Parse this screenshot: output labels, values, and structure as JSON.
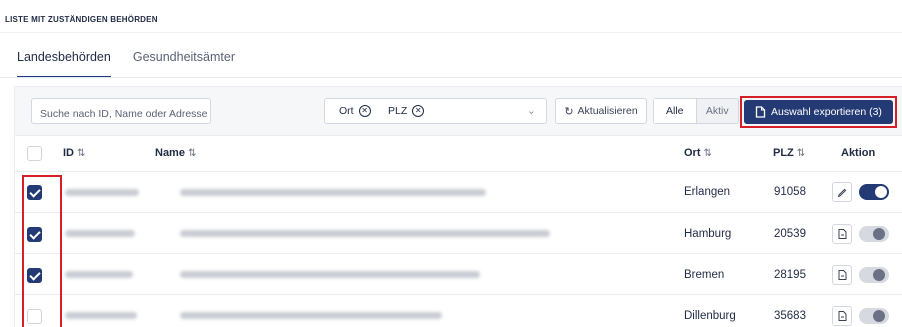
{
  "page_title": "LISTE MIT ZUSTÄNDIGEN BEHÖRDEN",
  "tabs": [
    {
      "label": "Landesbehörden",
      "active": true
    },
    {
      "label": "Gesundheitsämter",
      "active": false
    }
  ],
  "toolbar": {
    "search_placeholder": "Suche nach ID, Name oder Adresse",
    "filter_chips": [
      "Ort",
      "PLZ"
    ],
    "refresh_label": "Aktualisieren",
    "segment": [
      {
        "label": "Alle",
        "selected": true
      },
      {
        "label": "Aktiv",
        "selected": false
      }
    ],
    "export_label": "Auswahl exportieren (3)"
  },
  "columns": {
    "id": "ID",
    "name": "Name",
    "ort": "Ort",
    "plz": "PLZ",
    "aktion": "Aktion"
  },
  "sort_glyph": "⇅",
  "rows": [
    {
      "checked": true,
      "ort": "Erlangen",
      "plz": "91058",
      "action_icon": "pencil-icon",
      "active": true
    },
    {
      "checked": true,
      "ort": "Hamburg",
      "plz": "20539",
      "action_icon": "document-icon",
      "active": false
    },
    {
      "checked": true,
      "ort": "Bremen",
      "plz": "28195",
      "action_icon": "document-icon",
      "active": false
    },
    {
      "checked": false,
      "ort": "Dillenburg",
      "plz": "35683",
      "action_icon": "document-icon",
      "active": false
    }
  ],
  "colors": {
    "accent": "#233a74",
    "highlight": "#d61f26"
  }
}
